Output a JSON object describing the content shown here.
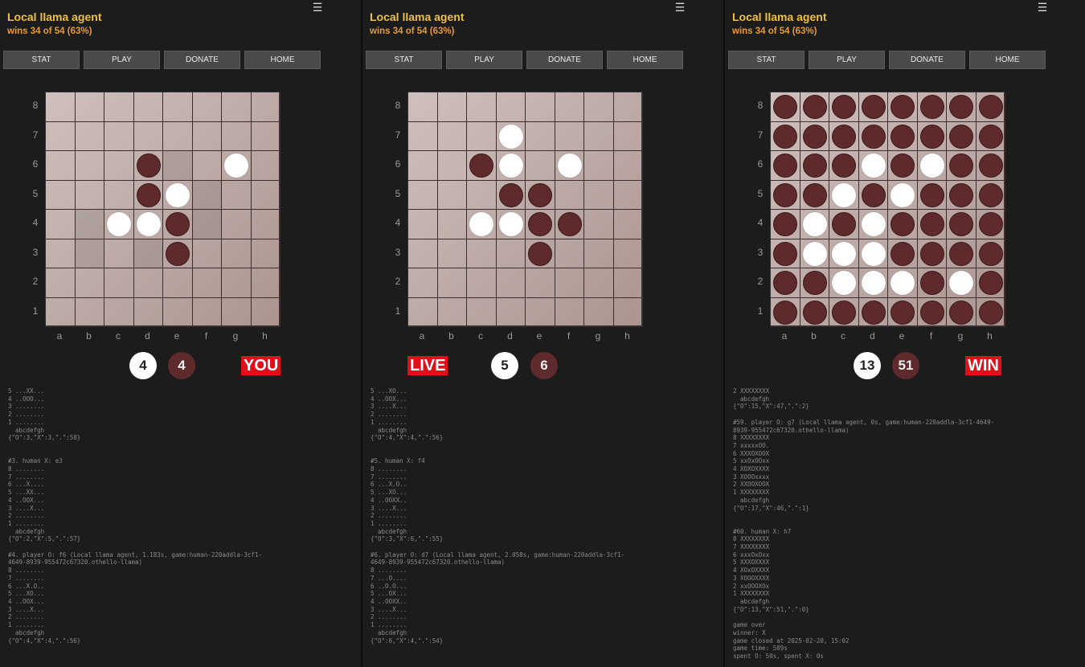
{
  "panels": [
    {
      "title": "Local llama agent",
      "subtitle": "wins 34 of 54 (63%)",
      "menu_icon": "☰",
      "nav": [
        "STAT",
        "PLAY",
        "DONATE",
        "HOME"
      ],
      "rows": [
        "8",
        "7",
        "6",
        "5",
        "4",
        "3",
        "2",
        "1"
      ],
      "cols": [
        "a",
        "b",
        "c",
        "d",
        "e",
        "f",
        "g",
        "h"
      ],
      "board": [
        "........",
        "........",
        "...Bx W.",
        "...BWx..",
        ".xWWBx..",
        ".x.xB...",
        "........",
        "........"
      ],
      "score_white": "4",
      "score_black": "4",
      "badge": "YOU",
      "log": [
        "5 ...XX...",
        "4 ..OOO...",
        "3 ........",
        "2 ........",
        "1 ........",
        "  abcdefgh",
        "{\"O\":3,\"X\":3,\".\":58}",
        "",
        "",
        "#3. human X: e3",
        "8 ........",
        "7 ........",
        "6 ...X....",
        "5 ...XX...",
        "4 ..OOX...",
        "3 ....X...",
        "2 ........",
        "1 ........",
        "  abcdefgh",
        "{\"O\":2,\"X\":5,\".\":57}",
        "",
        "#4. player O: f6 (Local llama agent, 1.183s, game:human-220addla-3cf1-",
        "4649-8939-955472c67320.othello-llama)",
        "8 ........",
        "7 ........",
        "6 ...X.O..",
        "5 ...XO...",
        "4 ..OOX...",
        "3 ....X...",
        "2 ........",
        "1 ........",
        "  abcdefgh",
        "{\"O\":4,\"X\":4,\".\":56}"
      ]
    },
    {
      "title": "Local llama agent",
      "subtitle": "wins 34 of 54 (63%)",
      "menu_icon": "☰",
      "nav": [
        "STAT",
        "PLAY",
        "DONATE",
        "HOME"
      ],
      "rows": [
        "8",
        "7",
        "6",
        "5",
        "4",
        "3",
        "2",
        "1"
      ],
      "cols": [
        "a",
        "b",
        "c",
        "d",
        "e",
        "f",
        "g",
        "h"
      ],
      "board": [
        "........",
        "...W....",
        "..BW.W..",
        "...BB...",
        "..WWBB..",
        "....B...",
        "........",
        "........"
      ],
      "score_white": "5",
      "score_black": "6",
      "badge": "LIVE",
      "log": [
        "5 ...XO...",
        "4 ..OOX...",
        "3 ....X...",
        "2 ........",
        "1 ........",
        "  abcdefgh",
        "{\"O\":4,\"X\":4,\".\":56}",
        "",
        "",
        "#5. human X: f4",
        "8 ........",
        "7 ........",
        "6 ...X.O..",
        "5 ...XO...",
        "4 ..OOXX..",
        "3 ....X...",
        "2 ........",
        "1 ........",
        "  abcdefgh",
        "{\"O\":3,\"X\":6,\".\":55}",
        "",
        "#6. player O: d7 (Local llama agent, 2.058s, game:human-220addla-3cf1-",
        "4649-8939-955472c67320.othello-llama)",
        "8 ........",
        "7 ...O....",
        "6 ..O.O...",
        "5 ...OX...",
        "4 ..OOXX..",
        "3 ....X...",
        "2 ........",
        "1 ........",
        "  abcdefgh",
        "{\"O\":6,\"X\":4,\".\":54}"
      ]
    },
    {
      "title": "Local llama agent",
      "subtitle": "wins 34 of 54 (63%)",
      "menu_icon": "☰",
      "nav": [
        "STAT",
        "PLAY",
        "DONATE",
        "HOME"
      ],
      "rows": [
        "8",
        "7",
        "6",
        "5",
        "4",
        "3",
        "2",
        "1"
      ],
      "cols": [
        "a",
        "b",
        "c",
        "d",
        "e",
        "f",
        "g",
        "h"
      ],
      "board": [
        "BBBBBBBB",
        "BBBBBBBB",
        "BBBWBWBB",
        "BBWBWBBB",
        "BWBWBBBB",
        "BWWWBBBB",
        "BBWWWBWB",
        "BBBBBBBB"
      ],
      "score_white": "13",
      "score_black": "51",
      "badge": "WIN",
      "log": [
        "2 XXXXXXXX",
        "  abcdefgh",
        "{\"O\":15,\"X\":47,\".\":2}",
        "",
        "#59. player O: g7 (Local llama agent, 0s, game:human-220addla-3cf1-4649-",
        "8939-955472c67320.othello-llama)",
        "8 XXXXXXXX",
        "7 xxxxxOO.",
        "6 XXXOXOOX",
        "5 xxOxOOxx",
        "4 XOXOXXXX",
        "3 XOOOxxxx",
        "2 XXOOXOOX",
        "1 XXXXXXXX",
        "  abcdefgh",
        "{\"O\":17,\"X\":46,\".\":1}",
        "",
        "",
        "#60. human X: h7",
        "8 XXXXXXXX",
        "7 XXXXXXXX",
        "6 xxxOxOxx",
        "5 XXXOXXXX",
        "4 XOxOXXXX",
        "3 XOOOXXXX",
        "2 xxOOOXOx",
        "1 XXXXXXXX",
        "  abcdefgh",
        "{\"O\":13,\"X\":51,\".\":0}",
        "",
        "game over",
        "winner: X",
        "game closed at 2025-02-20, 15:02",
        "game time: 589s",
        "spent O: 50s, spent X: 0s"
      ]
    }
  ]
}
